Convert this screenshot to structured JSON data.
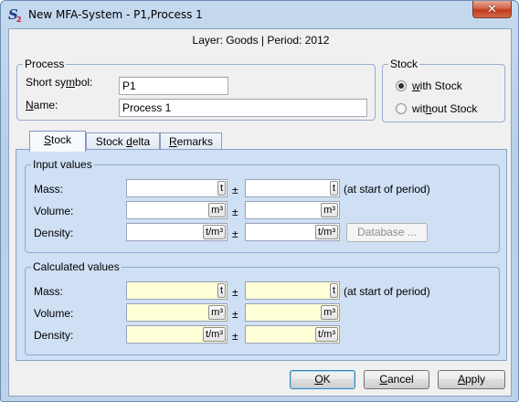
{
  "window": {
    "title": "New MFA-System - P1,Process 1",
    "close_symbol": "✕",
    "icon": "s2-app-icon"
  },
  "layer_info": "Layer: Goods | Period: 2012",
  "process": {
    "group_title": "Process",
    "short_symbol_label": "Short symbol:",
    "short_symbol_value": "P1",
    "name_label": "Name:",
    "name_value": "Process 1"
  },
  "stock": {
    "group_title": "Stock",
    "options": [
      {
        "label": "with Stock",
        "selected": true
      },
      {
        "label": "without Stock",
        "selected": false
      }
    ]
  },
  "tabs": [
    {
      "label": "Stock",
      "active": true
    },
    {
      "label": "Stock delta",
      "active": false
    },
    {
      "label": "Remarks",
      "active": false
    }
  ],
  "input_values": {
    "group_title": "Input values",
    "rows": [
      {
        "label": "Mass:",
        "unit": "t",
        "value": "",
        "error": "",
        "suffix": "(at start of period)"
      },
      {
        "label": "Volume:",
        "unit": "m³",
        "value": "",
        "error": ""
      },
      {
        "label": "Density:",
        "unit": "t/m³",
        "value": "",
        "error": ""
      }
    ],
    "database_button": "Database ..."
  },
  "calculated_values": {
    "group_title": "Calculated values",
    "rows": [
      {
        "label": "Mass:",
        "unit": "t",
        "value": "",
        "error": "",
        "suffix": "(at start of period)"
      },
      {
        "label": "Volume:",
        "unit": "m³",
        "value": "",
        "error": ""
      },
      {
        "label": "Density:",
        "unit": "t/m³",
        "value": "",
        "error": ""
      }
    ]
  },
  "plus_minus": "±",
  "buttons": {
    "ok": "OK",
    "cancel": "Cancel",
    "apply": "Apply"
  },
  "colors": {
    "calc_field": "#ffffd8",
    "tab_panel": "#cfdff4",
    "close_button": "#c2391b"
  }
}
